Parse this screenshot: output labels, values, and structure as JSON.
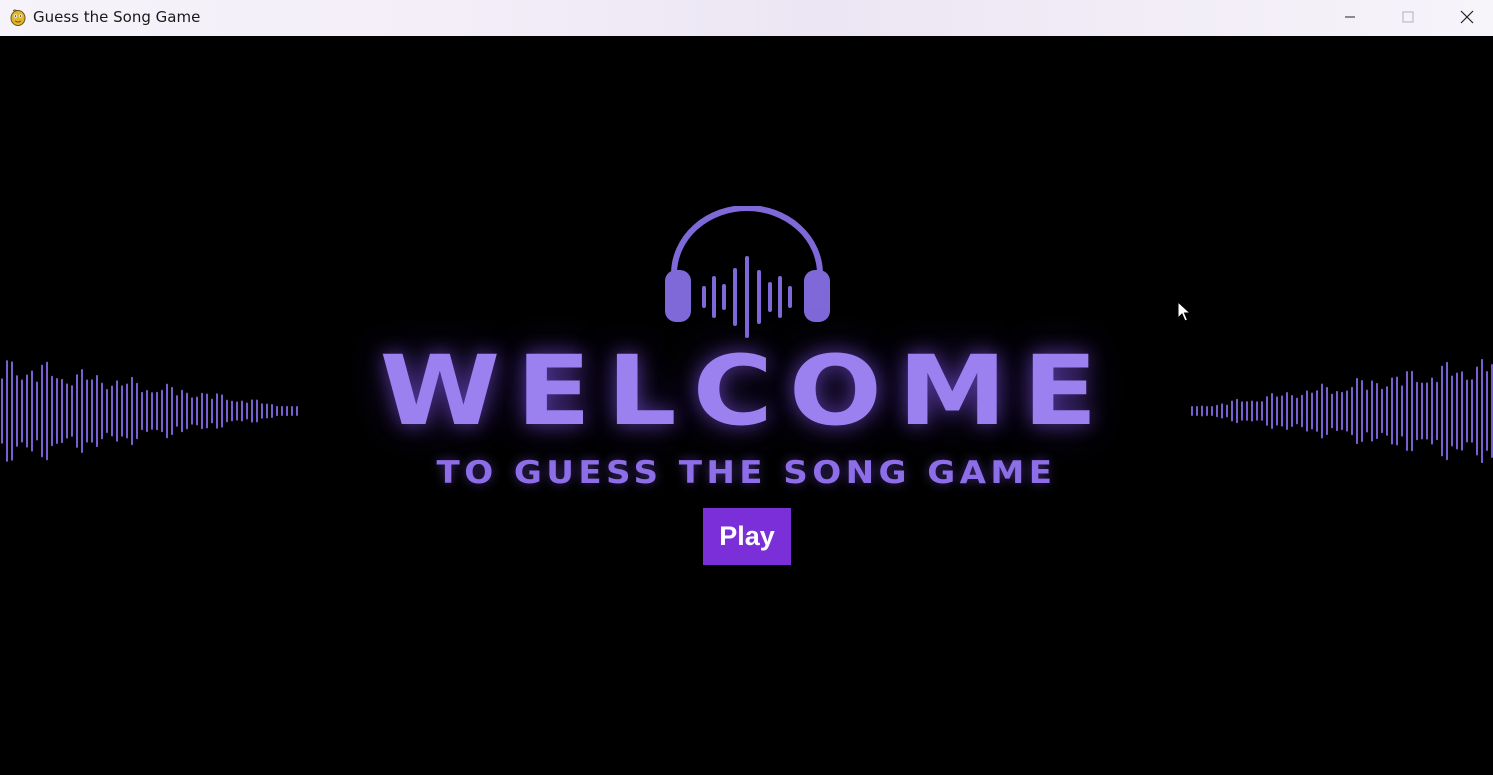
{
  "window": {
    "title": "Guess the Song Game",
    "app_icon": "pygame-snake-icon",
    "controls": [
      "minimize-icon",
      "maximize-icon",
      "close-icon"
    ]
  },
  "game": {
    "headline": "WELCOME",
    "subtitle": "TO GUESS THE SONG GAME",
    "play_label": "Play",
    "logo_icon": "headphones-soundwave-icon",
    "decoration": "soundwave-bars-icon"
  },
  "colors": {
    "background": "#000000",
    "headline": "#9b80f0",
    "subtitle": "#8d6ee8",
    "play_button": "#7b2fd8",
    "wave": "#7a5fd0"
  }
}
